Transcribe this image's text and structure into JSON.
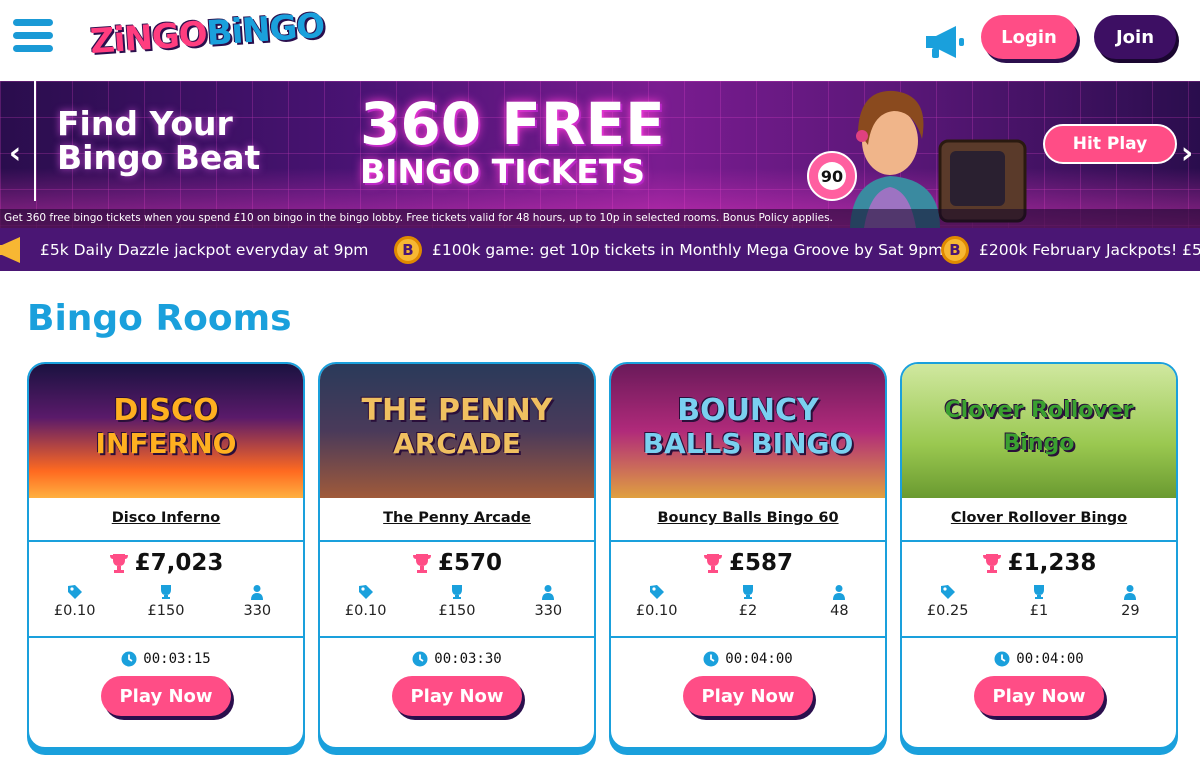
{
  "header": {
    "logo_part1": "ZiNGO",
    "logo_part2": "BiNGO",
    "menu_icon": "hamburger-icon",
    "announce_icon": "megaphone-icon",
    "login_label": "Login",
    "join_label": "Join",
    "colors": {
      "pink": "#ff4d86",
      "purple": "#3d0f63",
      "blue": "#1aa0dc"
    }
  },
  "banner": {
    "tagline_line1": "Find Your",
    "tagline_line2": "Bingo Beat",
    "headline": "360 FREE",
    "subheadline": "BINGO TICKETS",
    "ball_number": "90",
    "cta_label": "Hit Play",
    "disclaimer": "Get 360 free bingo tickets when you spend £10 on bingo in the bingo lobby. Free tickets valid for 48 hours, up to 10p in selected rooms. Bonus Policy applies.",
    "prev_icon": "chevron-left-icon",
    "next_icon": "chevron-right-icon"
  },
  "ticker": {
    "items": [
      "£5k Daily Dazzle jackpot everyday at 9pm",
      "£100k game: get 10p tickets in Monthly Mega Groove by Sat 9pm",
      "£200k February Jackpots! £5"
    ],
    "coin_letter": "B"
  },
  "section": {
    "title": "Bingo Rooms"
  },
  "rooms": [
    {
      "name": "Disco Inferno",
      "art_text1": "DISCO",
      "art_text2": "INFERNO",
      "jackpot": "£7,023",
      "ticket_price": "£0.10",
      "prize": "£150",
      "players": "330",
      "timer": "00:03:15",
      "play_label": "Play Now"
    },
    {
      "name": "The Penny Arcade",
      "art_text1": "THE PENNY",
      "art_text2": "ARCADE",
      "jackpot": "£570",
      "ticket_price": "£0.10",
      "prize": "£150",
      "players": "330",
      "timer": "00:03:30",
      "play_label": "Play Now"
    },
    {
      "name": "Bouncy Balls Bingo 60",
      "art_text1": "BOUNCY",
      "art_text2": "BALLS BINGO",
      "jackpot": "£587",
      "ticket_price": "£0.10",
      "prize": "£2",
      "players": "48",
      "timer": "00:04:00",
      "play_label": "Play Now"
    },
    {
      "name": "Clover Rollover Bingo",
      "art_text1": "Clover Rollover",
      "art_text2": "Bingo",
      "jackpot": "£1,238",
      "ticket_price": "£0.25",
      "prize": "£1",
      "players": "29",
      "timer": "00:04:00",
      "play_label": "Play Now"
    }
  ]
}
